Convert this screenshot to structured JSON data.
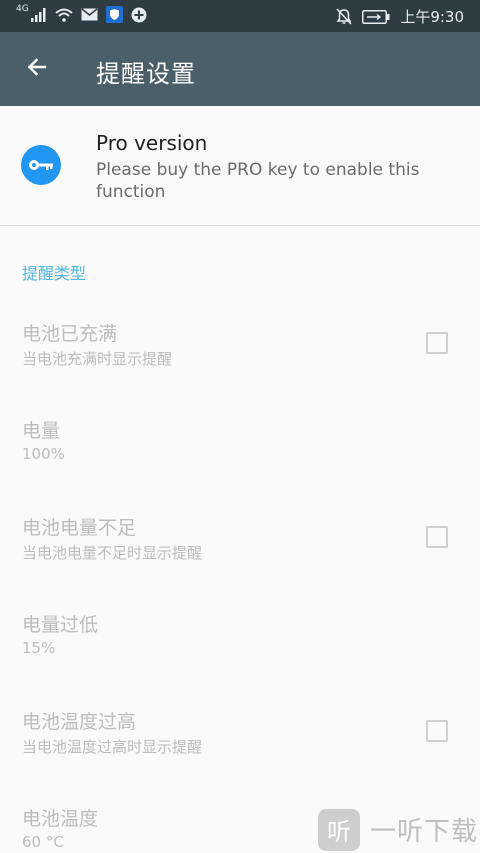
{
  "status_bar": {
    "network_label": "4G",
    "time": "上午9:30",
    "icons": [
      "signal-icon",
      "wifi-icon",
      "mail-icon",
      "shield-icon",
      "plus-circle-icon",
      "notifications-off-icon",
      "battery-charging-icon"
    ]
  },
  "app_bar": {
    "back_icon": "arrow-left-icon",
    "title": "提醒设置"
  },
  "pro": {
    "icon": "key-icon",
    "accent_color": "#2196f3",
    "title": "Pro version",
    "description": "Please buy the PRO key to enable this function"
  },
  "section": {
    "header": "提醒类型",
    "header_color": "#53b7e0"
  },
  "prefs": [
    {
      "title": "电池已充满",
      "summary": "当电池充满时显示提醒",
      "checkbox": true,
      "checked": false
    },
    {
      "title": "电量",
      "summary": "100%",
      "checkbox": false
    },
    {
      "title": "电池电量不足",
      "summary": "当电池电量不足时显示提醒",
      "checkbox": true,
      "checked": false
    },
    {
      "title": "电量过低",
      "summary": "15%",
      "checkbox": false
    },
    {
      "title": "电池温度过高",
      "summary": "当电池温度过高时显示提醒",
      "checkbox": true,
      "checked": false
    },
    {
      "title": "电池温度",
      "summary": "60 °C",
      "checkbox": false
    }
  ],
  "watermark": {
    "logo_char": "听",
    "text": "一听下载"
  }
}
